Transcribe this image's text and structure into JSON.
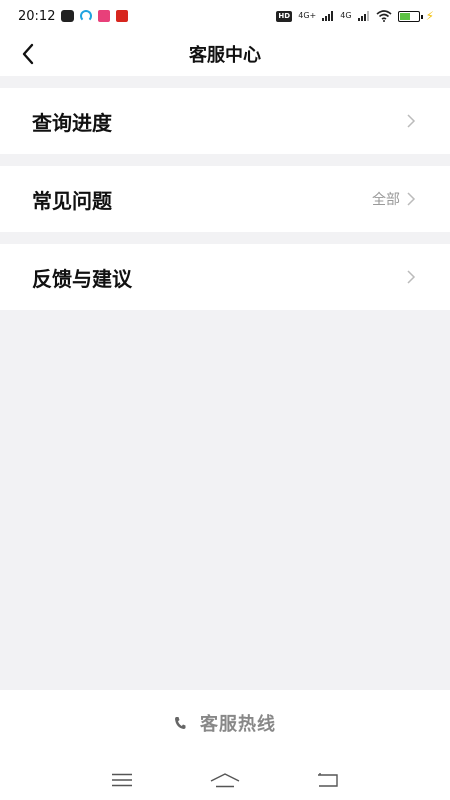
{
  "status_bar": {
    "time": "20:12",
    "hd_label": "HD",
    "signal1_label": "4G+",
    "signal2_label": "4G",
    "battery_percent": 60,
    "icons": [
      "notification-app-icon",
      "cloud-app-icon",
      "red-app-icon",
      "news-app-icon",
      "hd-icon",
      "signal-icon",
      "wifi-icon",
      "battery-icon",
      "charging-icon"
    ]
  },
  "header": {
    "title": "客服中心",
    "back_icon": "chevron-left-icon"
  },
  "menu": {
    "items": [
      {
        "label": "查询进度",
        "extra": ""
      },
      {
        "label": "常见问题",
        "extra": "全部"
      },
      {
        "label": "反馈与建议",
        "extra": ""
      }
    ],
    "arrow_icon": "chevron-right-icon"
  },
  "footer": {
    "hotline_label": "客服热线",
    "hotline_icon": "phone-icon"
  },
  "navbar": {
    "icons": [
      "menu-icon",
      "home-icon",
      "back-icon"
    ]
  },
  "colors": {
    "background": "#f2f2f4",
    "surface": "#ffffff",
    "text_primary": "#111111",
    "text_secondary": "#999999",
    "hotline_text": "#888888",
    "battery": "#5cc142",
    "charging": "#f2c10f"
  }
}
